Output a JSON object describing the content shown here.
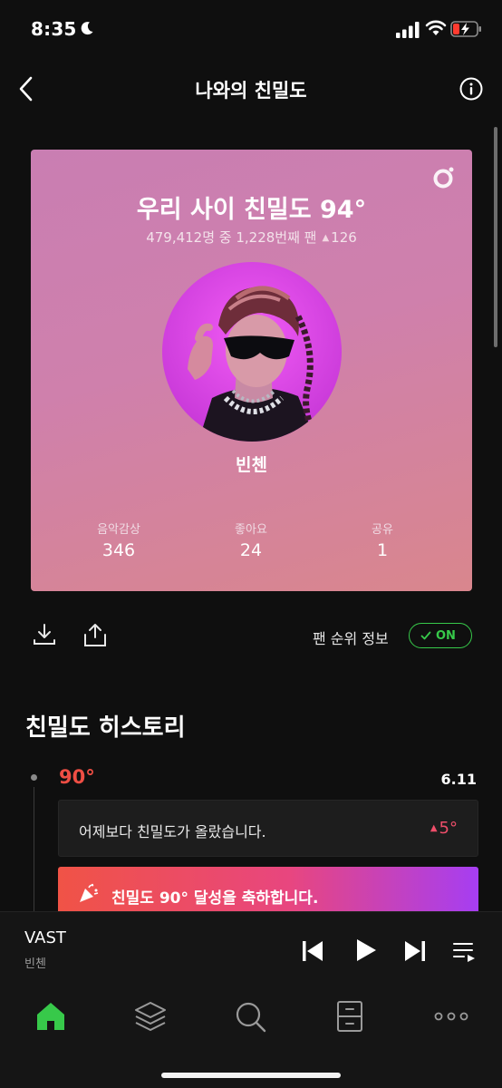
{
  "status_bar": {
    "time": "8:35"
  },
  "header": {
    "title": "나와의 친밀도"
  },
  "card": {
    "title": "우리 사이 친밀도 94°",
    "subtitle": "479,412명 중 1,228번째 팬",
    "rank_change": "126",
    "artist_name": "빈첸",
    "stats": [
      {
        "label": "음악감상",
        "value": "346"
      },
      {
        "label": "좋아요",
        "value": "24"
      },
      {
        "label": "공유",
        "value": "1"
      }
    ]
  },
  "actions": {
    "rank_info_label": "팬 순위 정보",
    "toggle_label": "ON"
  },
  "history": {
    "title": "친밀도 히스토리",
    "entry": {
      "level": "90°",
      "date": "6.11",
      "message": "어제보다 친밀도가 올랐습니다.",
      "delta": "5°",
      "banner": "친밀도 90° 달성을 축하합니다."
    }
  },
  "player": {
    "track": "VAST",
    "artist": "빈첸"
  },
  "colors": {
    "accent_green": "#37c94a",
    "level_red": "#ef4e44"
  }
}
